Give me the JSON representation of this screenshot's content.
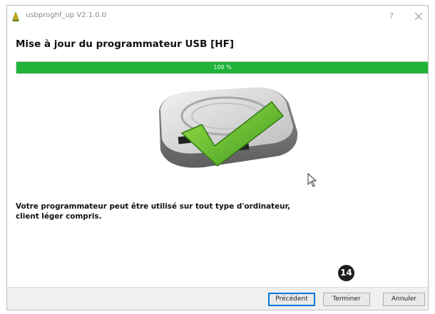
{
  "window": {
    "title": "usbproghf_up V2.1.0.0",
    "help_glyph": "?",
    "close_icon": "close-icon"
  },
  "wizard": {
    "heading": "Mise à jour du programmateur USB [HF]",
    "progress": {
      "percent": 100,
      "label": "100 %"
    },
    "message_line1": "Votre programmateur peut être utilisé sur tout type d'ordinateur,",
    "message_line2": "client léger compris."
  },
  "buttons": {
    "previous": "Précédent",
    "finish": "Terminer",
    "cancel": "Annuler"
  },
  "annotation": {
    "step_number": "14"
  },
  "colors": {
    "progress_fill": "#1fb33a",
    "checkmark": "#6cc12a",
    "default_button_border": "#0078d7"
  },
  "icons": [
    "app-icon",
    "close-icon",
    "usb-programmer-illustration",
    "checkmark-icon",
    "mouse-cursor-icon"
  ]
}
